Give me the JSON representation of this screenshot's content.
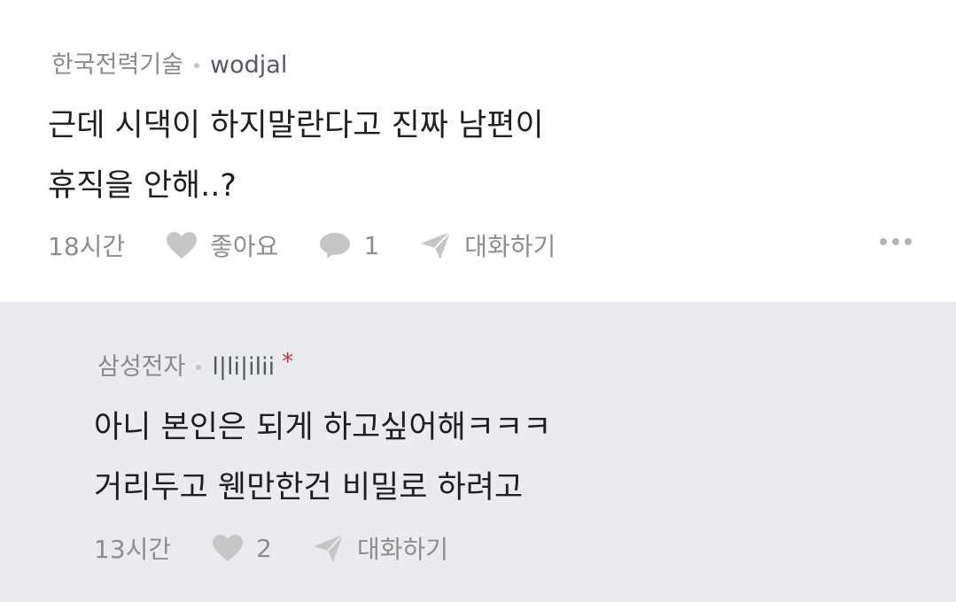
{
  "comments": [
    {
      "company": "한국전력기술",
      "username": "wodjal",
      "text": "근데 시댁이 하지말란다고 진짜 남편이\n휴직을 안해..?",
      "time": "18시간",
      "like_label": "좋아요",
      "comment_count": "1",
      "reply_label": "대화하기",
      "more_icon": "more-horizontal-icon"
    },
    {
      "company": "삼성전자",
      "username": "l|li|ilii",
      "author_marker": "*",
      "text": "아니 본인은 되게 하고싶어해ㅋㅋㅋ\n거리두고 웬만한건 비밀로 하려고",
      "time": "13시간",
      "like_count": "2",
      "reply_label": "대화하기"
    }
  ],
  "colors": {
    "top_background": "#ffffff",
    "reply_background": "#eaebee",
    "meta_gray": "#8a8a8a",
    "icon_gray": "#c6c6c6",
    "asterisk_red": "#d0312d"
  }
}
